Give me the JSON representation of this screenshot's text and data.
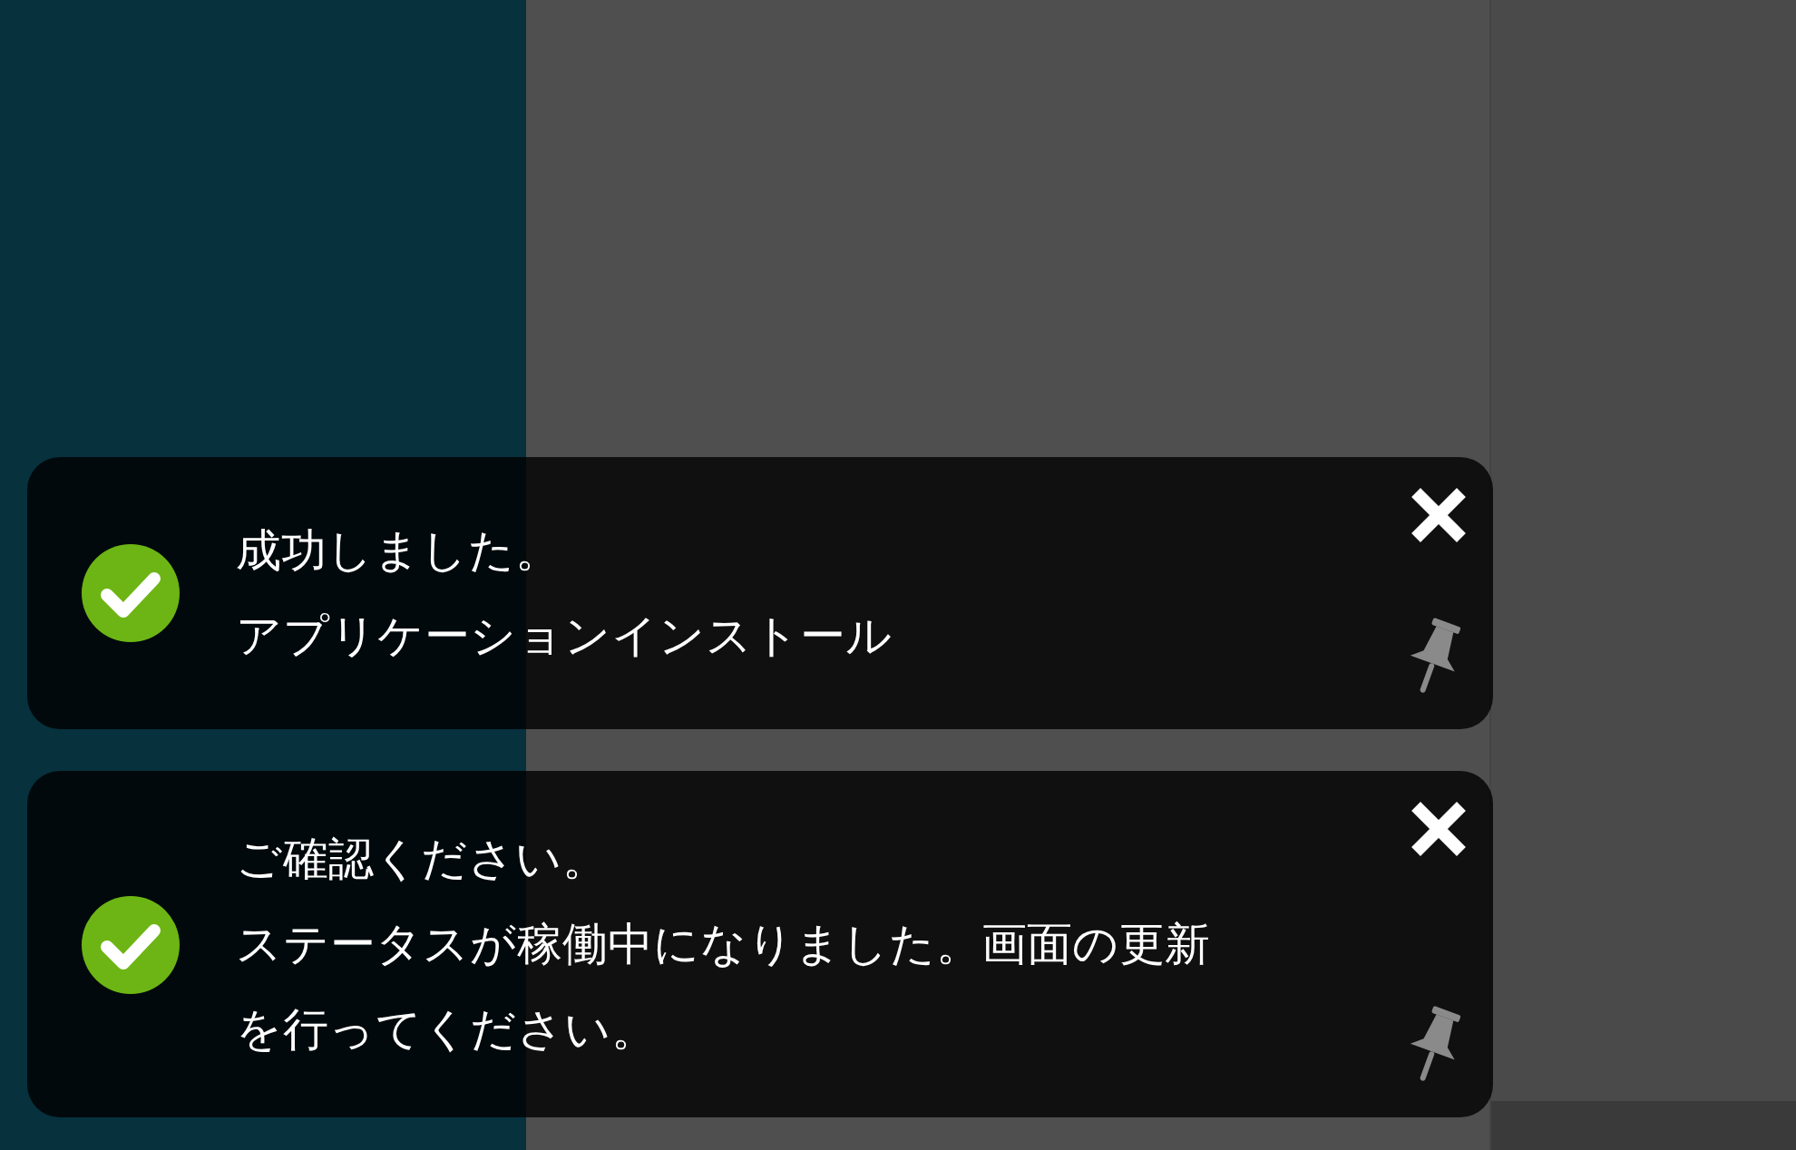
{
  "notifications": [
    {
      "kind": "success",
      "title": "成功しました。",
      "message": "アプリケーションインストール"
    },
    {
      "kind": "success",
      "title": "ご確認ください。",
      "message": "ステータスが稼働中になりました。画面の更新を行ってください。"
    }
  ]
}
